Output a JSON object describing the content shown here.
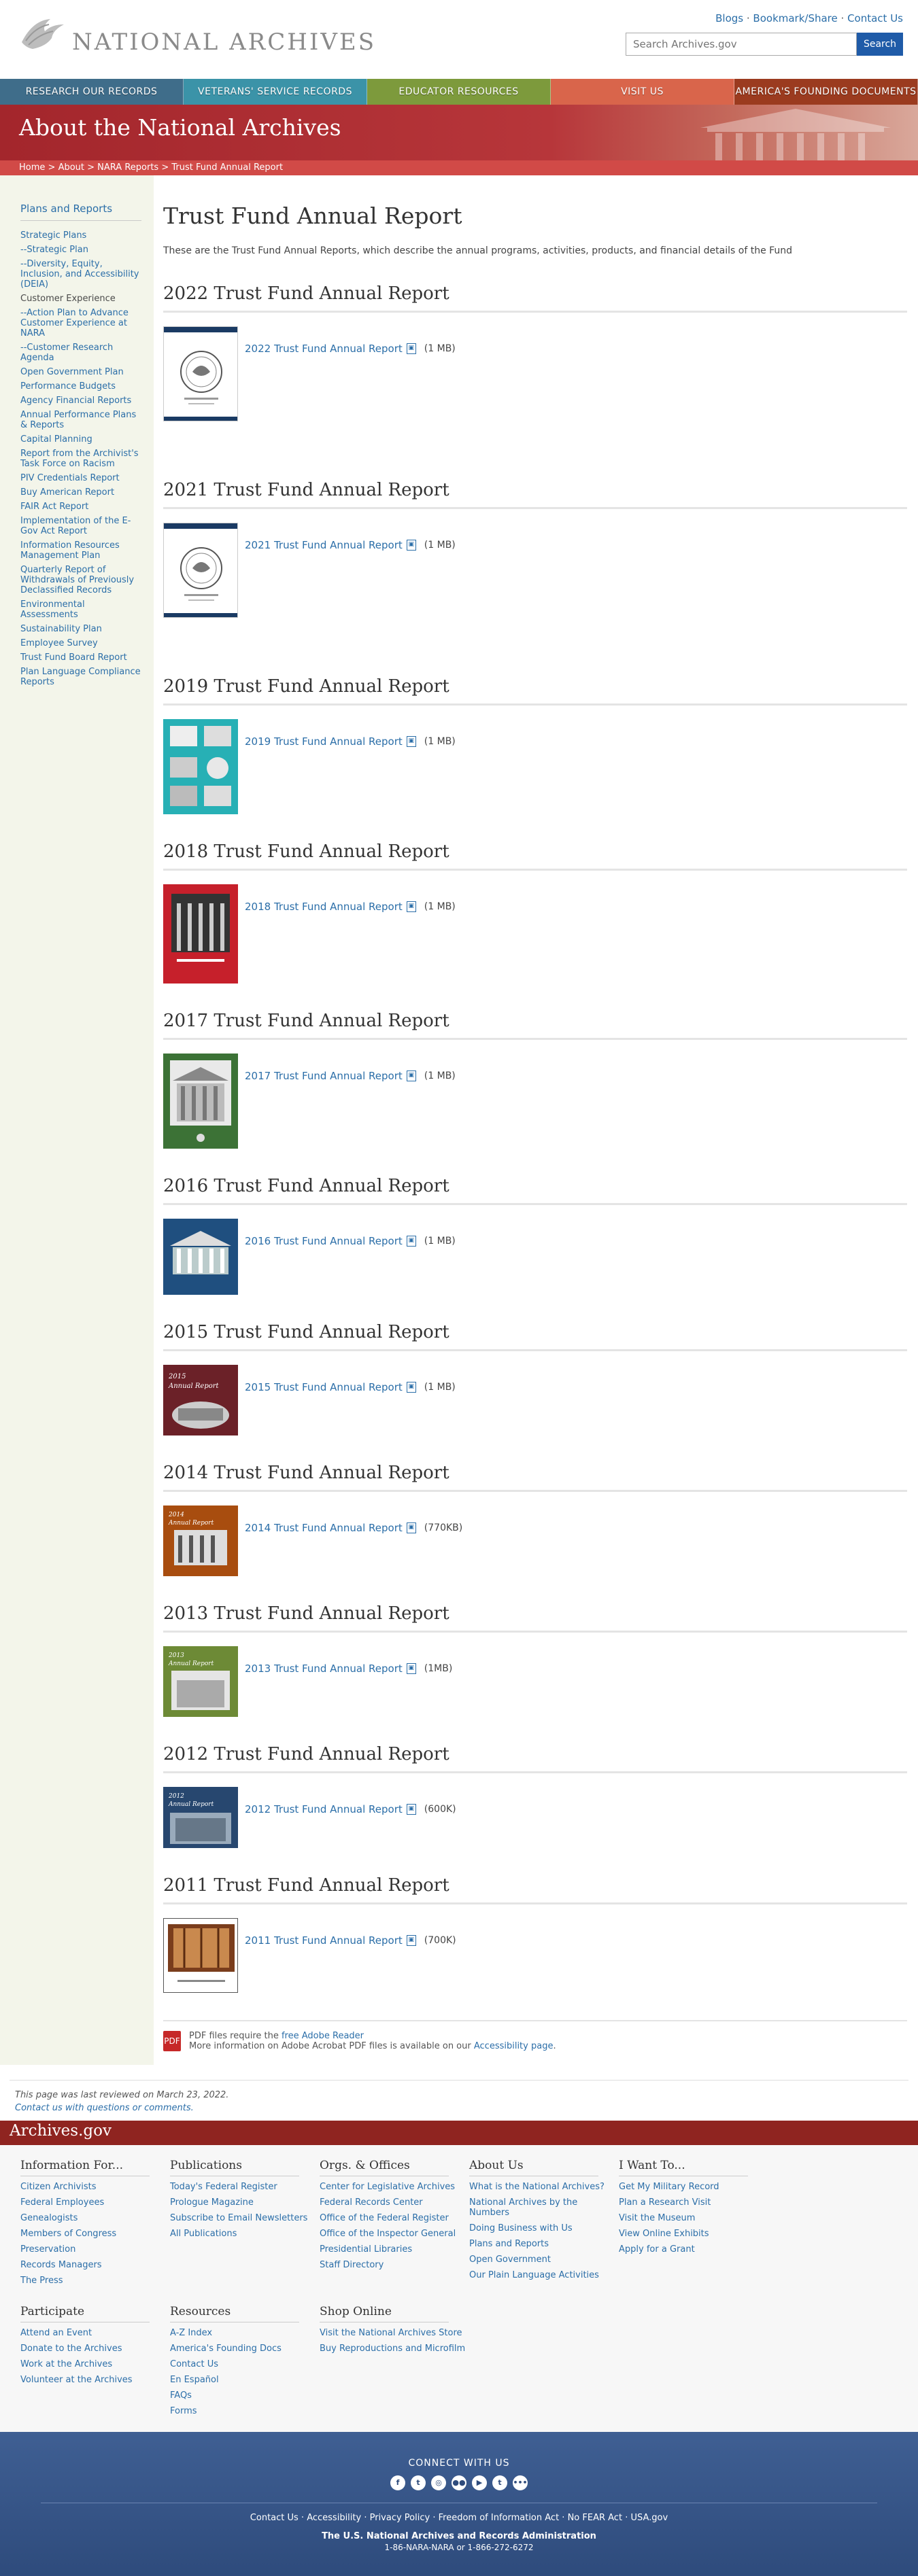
{
  "header": {
    "logo_text": "NATIONAL ARCHIVES",
    "utility_links": [
      "Blogs",
      "Bookmark/Share",
      "Contact Us"
    ],
    "search_placeholder": "Search Archives.gov",
    "search_button": "Search"
  },
  "nav": [
    {
      "label": "Research Our Records",
      "color": "#3f6d8a"
    },
    {
      "label": "Veterans' Service Records",
      "color": "#3b93a8"
    },
    {
      "label": "Educator Resources",
      "color": "#7d9a3c"
    },
    {
      "label": "Visit Us",
      "color": "#d9654b"
    },
    {
      "label": "America's Founding Documents",
      "color": "#9b3b1f"
    }
  ],
  "banner": {
    "title": "About the National Archives",
    "breadcrumb": [
      "Home",
      "About",
      "NARA Reports",
      "Trust Fund Annual Report"
    ]
  },
  "sidebar": {
    "heading": "Plans and Reports",
    "links": [
      {
        "label": "Strategic Plans",
        "gray": false
      },
      {
        "label": "--Strategic Plan",
        "gray": false
      },
      {
        "label": "--Diversity, Equity, Inclusion, and Accessibility (DEIA)",
        "gray": false
      },
      {
        "label": "Customer Experience",
        "gray": true
      },
      {
        "label": "--Action Plan to Advance Customer Experience at NARA",
        "gray": false
      },
      {
        "label": "--Customer Research Agenda",
        "gray": false
      },
      {
        "label": "Open Government Plan",
        "gray": false
      },
      {
        "label": "Performance Budgets",
        "gray": false
      },
      {
        "label": "Agency Financial Reports",
        "gray": false
      },
      {
        "label": "Annual Performance Plans & Reports",
        "gray": false
      },
      {
        "label": "Capital Planning",
        "gray": false
      },
      {
        "label": "Report from the Archivist's Task Force on Racism",
        "gray": false
      },
      {
        "label": "PIV Credentials Report",
        "gray": false
      },
      {
        "label": "Buy American Report",
        "gray": false
      },
      {
        "label": "FAIR Act Report",
        "gray": false
      },
      {
        "label": "Implementation of the E-Gov Act Report",
        "gray": false
      },
      {
        "label": "Information Resources Management Plan",
        "gray": false
      },
      {
        "label": "Quarterly Report of Withdrawals of Previously Declassified Records",
        "gray": false
      },
      {
        "label": "Environmental Assessments",
        "gray": false
      },
      {
        "label": "Sustainability Plan",
        "gray": false
      },
      {
        "label": "Employee Survey",
        "gray": false
      },
      {
        "label": "Trust Fund Board Report",
        "gray": false
      },
      {
        "label": "Plan Language Compliance Reports",
        "gray": false
      }
    ]
  },
  "main": {
    "title": "Trust Fund Annual Report",
    "intro": "These are the Trust Fund Annual Reports, which describe the annual programs, activities, products, and financial details of the Fund",
    "reports": [
      {
        "heading": "2022 Trust Fund Annual Report",
        "link": "2022 Trust Fund Annual Report",
        "size": "(1 MB)",
        "cover": "seal-white"
      },
      {
        "heading": "2021 Trust Fund Annual Report",
        "link": "2021 Trust Fund Annual Report",
        "size": "(1 MB)",
        "cover": "seal-white"
      },
      {
        "heading": "2019 Trust Fund Annual Report",
        "link": "2019 Trust Fund Annual Report",
        "size": "(1 MB)",
        "cover": "teal"
      },
      {
        "heading": "2018 Trust Fund Annual Report",
        "link": "2018 Trust Fund Annual Report",
        "size": "(1 MB)",
        "cover": "red"
      },
      {
        "heading": "2017 Trust Fund Annual Report",
        "link": "2017 Trust Fund Annual Report",
        "size": "(1 MB)",
        "cover": "green"
      },
      {
        "heading": "2016 Trust Fund Annual Report",
        "link": "2016 Trust Fund Annual Report",
        "size": "(1 MB)",
        "cover": "blue"
      },
      {
        "heading": "2015 Trust Fund Annual Report",
        "link": "2015 Trust Fund Annual Report",
        "size": "(1 MB)",
        "cover": "maroon"
      },
      {
        "heading": "2014 Trust Fund Annual Report",
        "link": "2014 Trust Fund Annual Report",
        "size": "(770KB)",
        "cover": "orange"
      },
      {
        "heading": "2013 Trust Fund Annual Report",
        "link": "2013 Trust Fund Annual Report",
        "size": "(1MB)",
        "cover": "olive"
      },
      {
        "heading": "2012 Trust Fund Annual Report",
        "link": "2012 Trust Fund Annual Report",
        "size": "(600K)",
        "cover": "navy"
      },
      {
        "heading": "2011 Trust Fund Annual Report",
        "link": "2011 Trust Fund Annual Report",
        "size": "(700K)",
        "cover": "library"
      }
    ],
    "pdf_note_prefix": "PDF files require the ",
    "pdf_note_link": "free Adobe Reader",
    "pdf_note_line2_prefix": "More information on Adobe Acrobat PDF files is available on our ",
    "pdf_note_line2_link": "Accessibility page",
    "pdf_icon_text": "PDF"
  },
  "review": {
    "text": "This page was last reviewed on March 23, 2022.",
    "contact": "Contact us with questions or comments."
  },
  "footer": {
    "site": "Archives.gov",
    "columns": [
      {
        "title": "Information For...",
        "links": [
          "Citizen Archivists",
          "Federal Employees",
          "Genealogists",
          "Members of Congress",
          "Preservation",
          "Records Managers",
          "The Press"
        ]
      },
      {
        "title": "Publications",
        "links": [
          "Today's Federal Register",
          "Prologue Magazine",
          "Subscribe to Email Newsletters",
          "All Publications"
        ]
      },
      {
        "title": "Orgs. & Offices",
        "links": [
          "Center for Legislative Archives",
          "Federal Records Center",
          "Office of the Federal Register",
          "Office of the Inspector General",
          "Presidential Libraries",
          "Staff Directory"
        ]
      },
      {
        "title": "About Us",
        "links": [
          "What is the National Archives?",
          "National Archives by the Numbers",
          "Doing Business with Us",
          "Plans and Reports",
          "Open Government",
          "Our Plain Language Activities"
        ]
      },
      {
        "title": "I Want To...",
        "links": [
          "Get My Military Record",
          "Plan a Research Visit",
          "Visit the Museum",
          "View Online Exhibits",
          "Apply for a Grant"
        ]
      },
      {
        "title": "Participate",
        "links": [
          "Attend an Event",
          "Donate to the Archives",
          "Work at the Archives",
          "Volunteer at the Archives"
        ]
      },
      {
        "title": "Resources",
        "links": [
          "A-Z Index",
          "America's Founding Docs",
          "Contact Us",
          "En Español",
          "FAQs",
          "Forms"
        ]
      },
      {
        "title": "Shop Online",
        "links": [
          "Visit the National Archives Store",
          "Buy Reproductions and Microfilm"
        ]
      }
    ],
    "connect": "CONNECT WITH US",
    "social_icons": [
      "facebook-icon",
      "twitter-icon",
      "instagram-icon",
      "flickr-icon",
      "youtube-icon",
      "tumblr-icon",
      "more-icon"
    ],
    "social_glyphs": [
      "f",
      "t",
      "◎",
      "●●",
      "▶",
      "t",
      "•••"
    ],
    "bottom_links": [
      "Contact Us",
      "Accessibility",
      "Privacy Policy",
      "Freedom of Information Act",
      "No FEAR Act",
      "USA.gov"
    ],
    "agency": "The U.S. National Archives and Records Administration",
    "phone": "1-86-NARA-NARA or 1-866-272-6272"
  }
}
